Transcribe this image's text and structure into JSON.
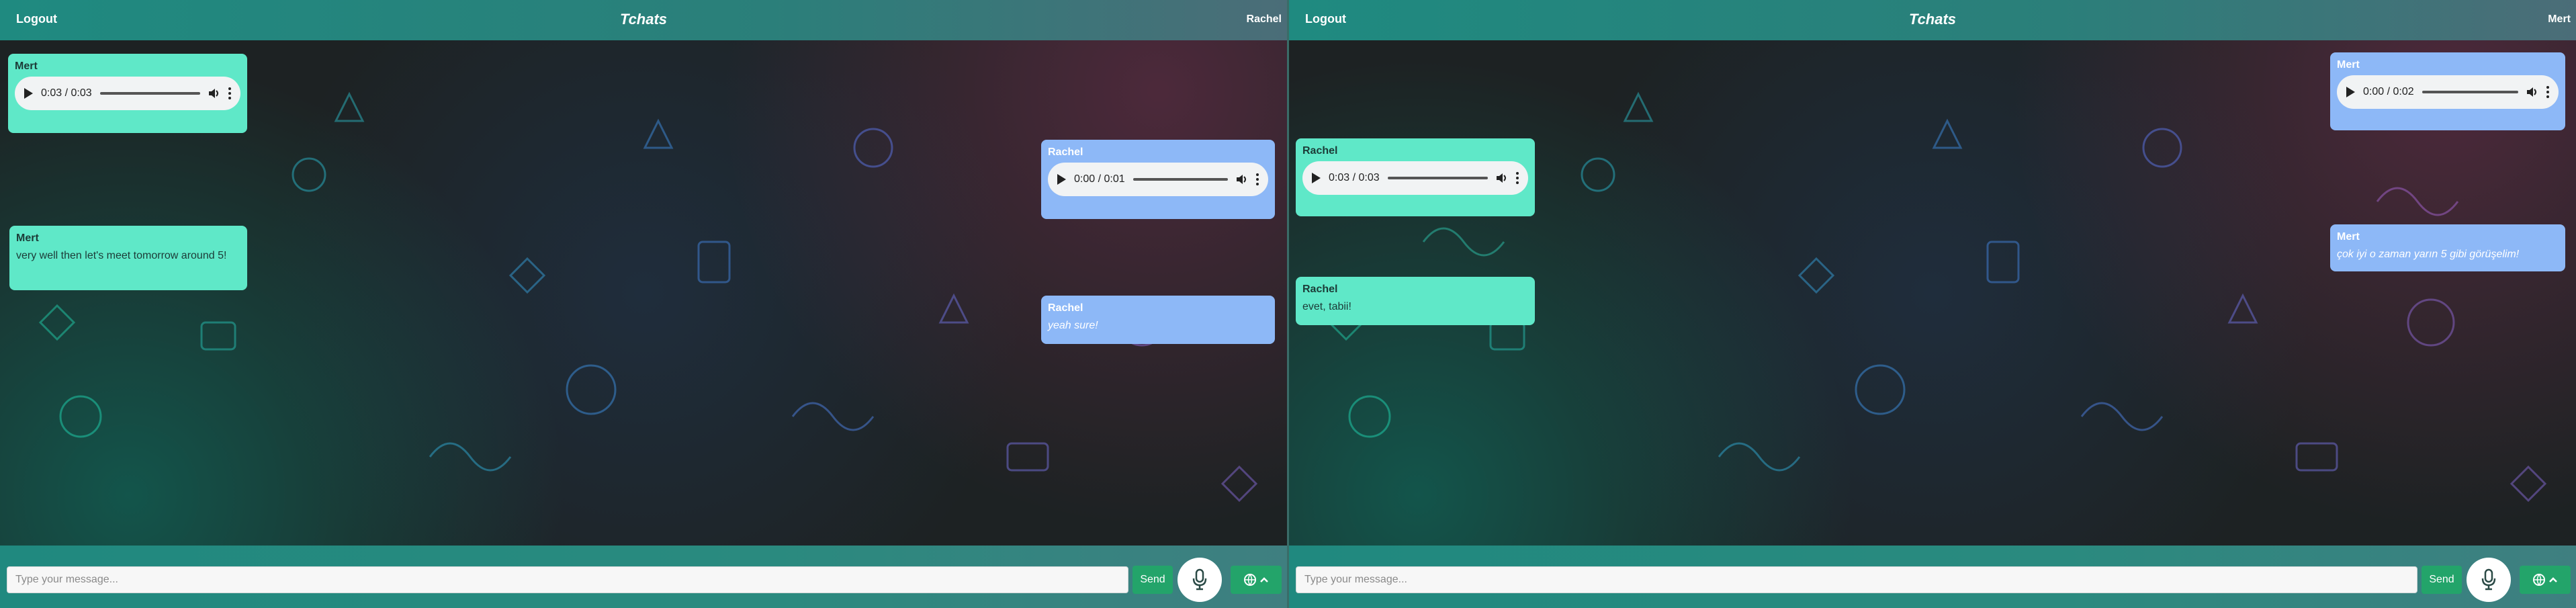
{
  "colors": {
    "accent": "#1f8a80",
    "sent_bubble": "#5fe8c8",
    "received_bubble": "#8db8f7",
    "send_button": "#23a46a"
  },
  "left": {
    "header": {
      "logout_label": "Logout",
      "app_title": "Tchats",
      "username": "Rachel"
    },
    "messages": [
      {
        "sender": "Mert",
        "type": "audio",
        "time": "0:03 / 0:03"
      },
      {
        "sender": "Rachel",
        "type": "audio",
        "time": "0:00 / 0:01"
      },
      {
        "sender": "Mert",
        "type": "text",
        "text": "very well then let's meet tomorrow around 5!"
      },
      {
        "sender": "Rachel",
        "type": "text",
        "text": "yeah sure!"
      }
    ],
    "composer": {
      "placeholder": "Type your message...",
      "send_label": "Send"
    }
  },
  "right": {
    "header": {
      "logout_label": "Logout",
      "app_title": "Tchats",
      "username": "Mert"
    },
    "messages": [
      {
        "sender": "Mert",
        "type": "audio",
        "time": "0:00 / 0:02"
      },
      {
        "sender": "Rachel",
        "type": "audio",
        "time": "0:03 / 0:03"
      },
      {
        "sender": "Mert",
        "type": "text",
        "text": "çok iyi o zaman yarın 5 gibi görüşelim!"
      },
      {
        "sender": "Rachel",
        "type": "text",
        "text": "evet, tabii!"
      }
    ],
    "composer": {
      "placeholder": "Type your message...",
      "send_label": "Send"
    }
  },
  "icons": {
    "mic": "microphone-icon",
    "language": "globe-icon",
    "language_toggle": "chevron-up-icon",
    "play": "play-icon",
    "volume": "volume-icon",
    "more": "more-vertical-icon"
  }
}
